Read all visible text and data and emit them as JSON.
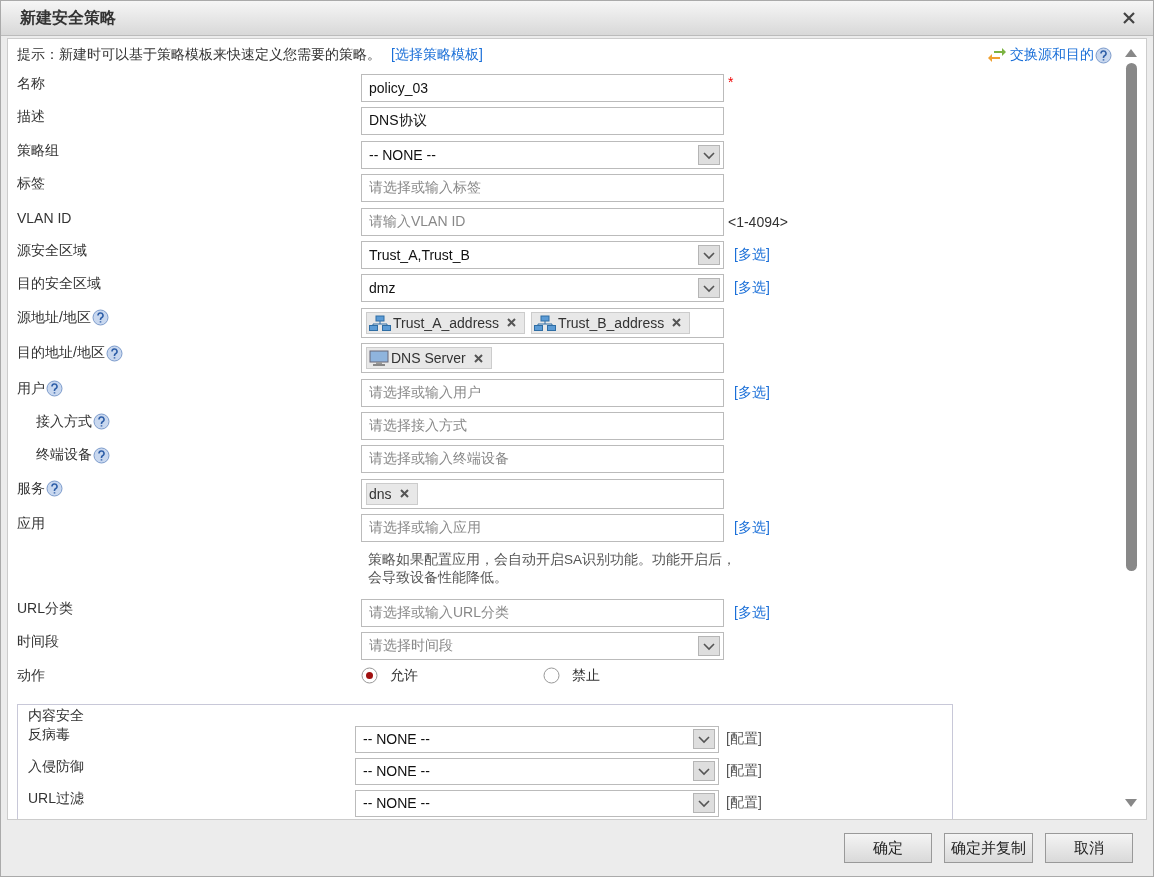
{
  "dialog": {
    "title": "新建安全策略"
  },
  "hint": {
    "text": "提示：新建时可以基于策略模板来快速定义您需要的策略。",
    "link": "[选择策略模板]"
  },
  "swap_link": "交换源和目的",
  "rows": [
    {
      "label": "名称",
      "help": false,
      "indent": false,
      "kind": "text",
      "value": "policy_03",
      "required_mark": "*"
    },
    {
      "label": "描述",
      "help": false,
      "indent": false,
      "kind": "text",
      "value": "DNS协议"
    },
    {
      "label": "策略组",
      "help": false,
      "indent": false,
      "kind": "select",
      "value": "-- NONE --"
    },
    {
      "label": "标签",
      "help": false,
      "indent": false,
      "kind": "text",
      "placeholder": "请选择或输入标签"
    },
    {
      "label": "VLAN ID",
      "help": false,
      "indent": false,
      "kind": "text",
      "placeholder": "请输入VLAN ID",
      "range": "<1-4094>"
    },
    {
      "label": "源安全区域",
      "help": false,
      "indent": false,
      "kind": "select",
      "value": "Trust_A,Trust_B",
      "link": "[多选]"
    },
    {
      "label": "目的安全区域",
      "help": false,
      "indent": false,
      "kind": "select",
      "value": "dmz",
      "link": "[多选]"
    },
    {
      "label": "源地址/地区",
      "help": true,
      "indent": false,
      "kind": "tags",
      "tags": [
        {
          "kind": "network",
          "text": "Trust_A_address"
        },
        {
          "kind": "network",
          "text": "Trust_B_address"
        }
      ]
    },
    {
      "label": "目的地址/地区",
      "help": true,
      "indent": false,
      "kind": "tags",
      "tags": [
        {
          "kind": "computer",
          "text": "DNS Server"
        }
      ]
    },
    {
      "label": "用户",
      "help": true,
      "indent": false,
      "kind": "text",
      "placeholder": "请选择或输入用户",
      "link": "[多选]"
    },
    {
      "label": "接入方式",
      "help": true,
      "indent": true,
      "kind": "text",
      "placeholder": "请选择接入方式"
    },
    {
      "label": "终端设备",
      "help": true,
      "indent": true,
      "kind": "text",
      "placeholder": "请选择或输入终端设备"
    },
    {
      "label": "服务",
      "help": true,
      "indent": false,
      "kind": "tags",
      "tags": [
        {
          "kind": "plain",
          "text": "dns"
        }
      ]
    },
    {
      "label": "应用",
      "help": false,
      "indent": false,
      "kind": "text",
      "placeholder": "请选择或输入应用",
      "link": "[多选]",
      "note": "策略如果配置应用，会自动开启SA识别功能。功能开启后，会导致设备性能降低。"
    },
    {
      "label": "URL分类",
      "help": false,
      "indent": false,
      "kind": "text",
      "placeholder": "请选择或输入URL分类",
      "link": "[多选]"
    },
    {
      "label": "时间段",
      "help": false,
      "indent": false,
      "kind": "select",
      "placeholder": "请选择时间段"
    },
    {
      "label": "动作",
      "help": false,
      "indent": false,
      "kind": "radio",
      "options": [
        {
          "label": "允许",
          "selected": true
        },
        {
          "label": "禁止",
          "selected": false
        }
      ]
    }
  ],
  "content_security": {
    "title": "内容安全",
    "rows": [
      {
        "label": "反病毒",
        "value": "-- NONE --",
        "link": "[配置]"
      },
      {
        "label": "入侵防御",
        "value": "-- NONE --",
        "link": "[配置]"
      },
      {
        "label": "URL过滤",
        "value": "-- NONE --",
        "link": "[配置]"
      }
    ]
  },
  "buttons": [
    "确定",
    "确定并复制",
    "取消"
  ]
}
